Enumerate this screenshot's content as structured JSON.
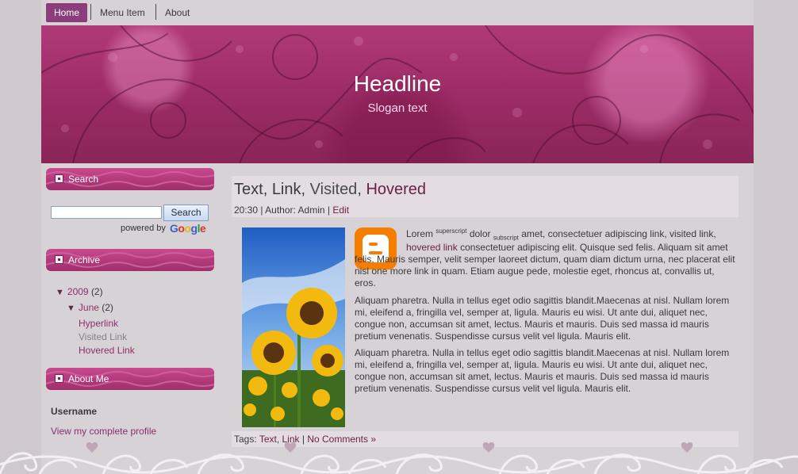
{
  "nav": {
    "items": [
      "Home",
      "Menu Item",
      "About"
    ]
  },
  "header": {
    "headline": "Headline",
    "slogan": "Slogan text"
  },
  "sidebar": {
    "search": {
      "title": "Search",
      "button": "Search",
      "powered": "powered by",
      "google": "Google"
    },
    "archive": {
      "title": "Archive",
      "year": "2009",
      "year_count": "(2)",
      "month": "June",
      "month_count": "(2)",
      "links": [
        "Hyperlink",
        "Visited Link",
        "Hovered Link"
      ]
    },
    "about": {
      "title": "About Me",
      "username": "Username",
      "profile_link": "View my complete profile"
    }
  },
  "post": {
    "title_text": "Text",
    "title_link": "Link",
    "title_visited": "Visited",
    "title_hovered": "Hovered",
    "sep": ", ",
    "meta_time": "20:30",
    "meta_author_label": "Author:",
    "meta_author": "Admin",
    "meta_edit": "Edit",
    "p1_lorem": "Lorem",
    "p1_sup": "superscript",
    "p1_dolor": "dolor",
    "p1_sub": "subscript",
    "p1_rest": "amet, consectetuer adipiscing link, visited link,",
    "p1_hovered": "hovered link",
    "p1_tail": "consectetuer adipiscing elit. Quisque sed felis. Aliquam sit amet felis. Mauris semper, velit semper laoreet dictum, quam diam dictum urna, nec placerat elit nisl one more link in quam. Etiam augue pede, molestie eget, rhoncus at, convallis ut, eros.",
    "p2": "Aliquam pharetra. Nulla in tellus eget odio sagittis blandit.Maecenas at nisl. Nullam lorem mi, eleifend a, fringilla vel, semper at, ligula. Mauris eu wisi. Ut ante dui, aliquet nec, congue non, accumsan sit amet, lectus. Mauris et mauris. Duis sed massa id mauris pretium venenatis. Suspendisse cursus velit vel ligula. Mauris elit.",
    "p3": "Aliquam pharetra. Nulla in tellus eget odio sagittis blandit.Maecenas at nisl. Nullam lorem mi, eleifend a, fringilla vel, semper at, ligula. Mauris eu wisi. Ut ante dui, aliquet nec, congue non, accumsan sit amet, lectus. Mauris et mauris. Duis sed massa id mauris pretium venenatis. Suspendisse cursus velit vel ligula. Mauris elit.",
    "tags_label": "Tags:",
    "tag1": "Text",
    "tag2": "Link",
    "comments": "No Comments »"
  },
  "colors": {
    "accent": "#8c3d7c",
    "header": "#a3306b",
    "link": "#8c2f6a",
    "blogger": "#f57d00"
  }
}
